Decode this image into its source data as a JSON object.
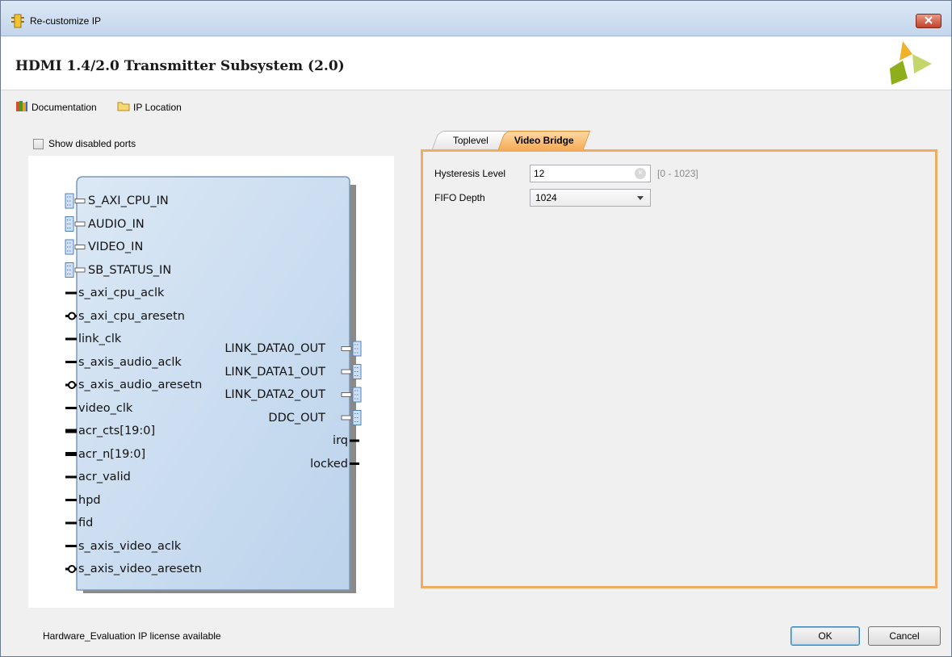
{
  "window": {
    "title": "Re-customize IP"
  },
  "header": {
    "title": "HDMI 1.4/2.0 Transmitter Subsystem (2.0)"
  },
  "toolbar": {
    "documentation": "Documentation",
    "ip_location": "IP Location"
  },
  "left_panel": {
    "show_disabled_ports": "Show disabled ports",
    "show_disabled_checked": false,
    "left_bus_ports": [
      "S_AXI_CPU_IN",
      "AUDIO_IN",
      "VIDEO_IN",
      "SB_STATUS_IN"
    ],
    "left_ports": [
      "s_axi_cpu_aclk",
      "s_axi_cpu_aresetn",
      "link_clk",
      "s_axis_audio_aclk",
      "s_axis_audio_aresetn",
      "video_clk",
      "acr_cts[19:0]",
      "acr_n[19:0]",
      "acr_valid",
      "hpd",
      "fid",
      "s_axis_video_aclk",
      "s_axis_video_aresetn"
    ],
    "right_bus_ports": [
      "LINK_DATA0_OUT",
      "LINK_DATA1_OUT",
      "LINK_DATA2_OUT",
      "DDC_OUT"
    ],
    "right_ports": [
      "irq",
      "locked"
    ]
  },
  "tabs": [
    {
      "label": "Toplevel",
      "active": false
    },
    {
      "label": "Video Bridge",
      "active": true
    }
  ],
  "video_bridge": {
    "hysteresis_label": "Hysteresis Level",
    "hysteresis_value": "12",
    "hysteresis_range": "[0 - 1023]",
    "fifo_label": "FIFO Depth",
    "fifo_value": "1024"
  },
  "footer": {
    "license_text": "Hardware_Evaluation IP license available",
    "ok_label": "OK",
    "cancel_label": "Cancel"
  },
  "colors": {
    "accent": "#f0ac60",
    "block_fill": "#c9dcf0",
    "block_border": "#7a98b8"
  }
}
